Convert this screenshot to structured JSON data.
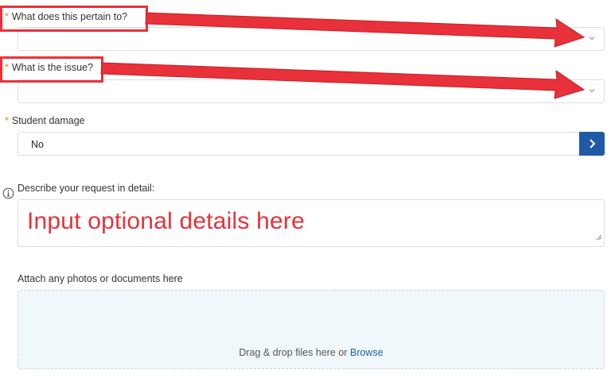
{
  "form": {
    "q1": {
      "required_mark": "*",
      "label": "What does this pertain to?",
      "value": ""
    },
    "q2": {
      "required_mark": "*",
      "label": "What is the issue?",
      "value": ""
    },
    "q3": {
      "required_mark": "*",
      "label": "Student damage",
      "value": "No"
    },
    "details": {
      "label": "Describe your request in detail:",
      "value": ""
    },
    "attach": {
      "label": "Attach any photos or documents here",
      "dropzone_text": "Drag & drop files here or ",
      "browse_label": "Browse"
    }
  },
  "annotation": {
    "text": "Input optional details here",
    "color": "#e8313a"
  },
  "icons": {
    "chevron": "chevron-down-icon",
    "next": "chevron-right-icon",
    "info": "info-circle-icon"
  },
  "colors": {
    "accent": "#1f5aa6",
    "required": "#e8850c",
    "annotation": "#e8313a",
    "dropzone_bg": "#f1f8fb"
  }
}
